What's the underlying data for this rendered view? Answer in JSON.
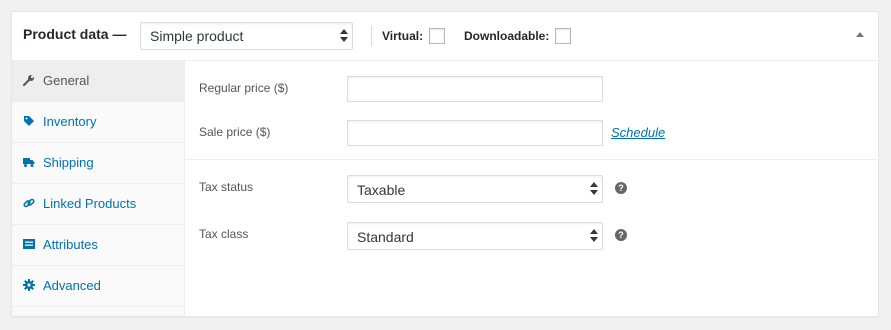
{
  "header": {
    "title": "Product data —",
    "product_type": "Simple product",
    "virtual_label": "Virtual:",
    "virtual_checked": false,
    "downloadable_label": "Downloadable:",
    "downloadable_checked": false
  },
  "tabs": [
    {
      "label": "General",
      "icon": "wrench-icon",
      "active": true
    },
    {
      "label": "Inventory",
      "icon": "tag-icon",
      "active": false
    },
    {
      "label": "Shipping",
      "icon": "truck-icon",
      "active": false
    },
    {
      "label": "Linked Products",
      "icon": "link-icon",
      "active": false
    },
    {
      "label": "Attributes",
      "icon": "list-icon",
      "active": false
    },
    {
      "label": "Advanced",
      "icon": "gear-icon",
      "active": false
    }
  ],
  "general": {
    "regular_price_label": "Regular price ($)",
    "regular_price_value": "",
    "sale_price_label": "Sale price ($)",
    "sale_price_value": "",
    "schedule_link": "Schedule",
    "tax_status_label": "Tax status",
    "tax_status_value": "Taxable",
    "tax_class_label": "Tax class",
    "tax_class_value": "Standard",
    "help_glyph": "?"
  },
  "colors": {
    "link": "#0073aa",
    "active_tab_bg": "#eeeeee",
    "panel_bg": "#ffffff",
    "page_bg": "#f1f1f1"
  }
}
